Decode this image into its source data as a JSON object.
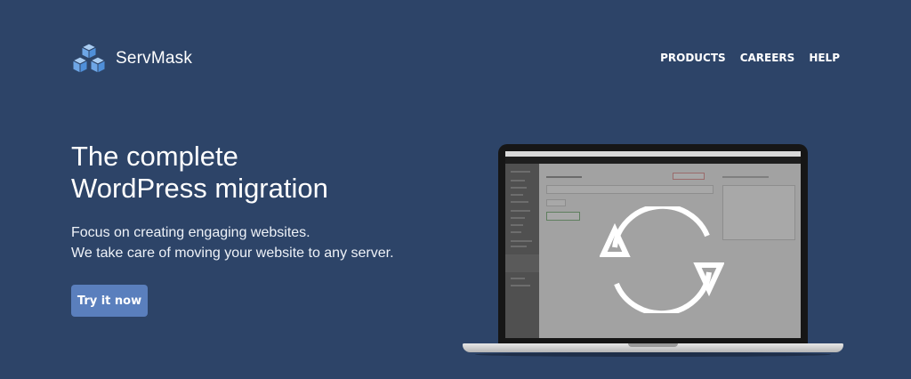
{
  "brand": {
    "name": "ServMask",
    "logo_icon": "stacked-cubes-icon",
    "accent": "#4f8fd9"
  },
  "nav": {
    "items": [
      "PRODUCTS",
      "CAREERS",
      "HELP"
    ]
  },
  "hero": {
    "title_line1": "The complete",
    "title_line2": "WordPress migration",
    "subtitle_line1": "Focus on creating engaging websites.",
    "subtitle_line2": "We take care of moving your website to any server.",
    "cta_label": "Try it now"
  },
  "illustration": {
    "device": "laptop",
    "overlay_icon": "sync-arrows-icon"
  },
  "colors": {
    "background": "#2d4468",
    "button": "#5a7fbd"
  }
}
